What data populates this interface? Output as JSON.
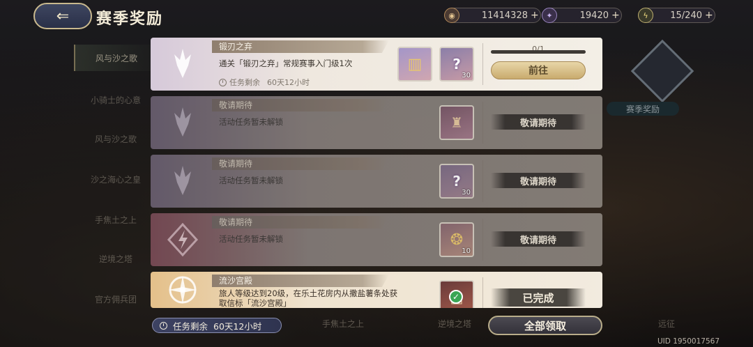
{
  "header": {
    "title": "赛季奖励",
    "back_icon": "back-arrow-icon"
  },
  "currencies": [
    {
      "icon": "coin-icon",
      "value": "11414328"
    },
    {
      "icon": "star-gem-icon",
      "value": "19420"
    },
    {
      "icon": "lightning-icon",
      "value": "15/240"
    }
  ],
  "sidebar": {
    "items": [
      {
        "label": "风与沙之歌",
        "active": true
      },
      {
        "label": "小骑士的心意"
      },
      {
        "label": "风与沙之歌"
      },
      {
        "label": "沙之海心之皇"
      },
      {
        "label": "手焦土之上"
      },
      {
        "label": "逆境之塔"
      },
      {
        "label": "官方佣兵团"
      }
    ]
  },
  "right_panel": {
    "season_label": "赛季奖励"
  },
  "tasks": [
    {
      "state": "active",
      "title": "锻刃之弃",
      "desc": "通关「锻刃之弃」常规赛事入门级1次",
      "time_label": "任务剩余",
      "time_value": "60天12小时",
      "rewards": [
        {
          "qty": ""
        },
        {
          "qty": "30",
          "mystery": "?"
        }
      ],
      "progress": "0/1",
      "button": "前往"
    },
    {
      "state": "locked",
      "title": "敬请期待",
      "desc": "活动任务暂未解锁",
      "rewards": [
        {
          "qty": ""
        }
      ],
      "button": "敬请期待"
    },
    {
      "state": "locked",
      "title": "敬请期待",
      "desc": "活动任务暂未解锁",
      "rewards": [
        {
          "qty": "30",
          "mystery": "?"
        }
      ],
      "button": "敬请期待"
    },
    {
      "state": "locked",
      "title": "敬请期待",
      "desc": "活动任务暂未解锁",
      "rewards": [
        {
          "qty": "10"
        }
      ],
      "button": "敬请期待"
    },
    {
      "state": "done",
      "title": "流沙宫殿",
      "desc": "旅人等级达到20级，在乐土花房内从撒盐薯条处获取信标「流沙宫殿」",
      "rewards": [
        {
          "qty": ""
        }
      ],
      "button": "已完成"
    }
  ],
  "bottom": {
    "timer_label": "任务剩余",
    "timer_value": "60天12小时",
    "claim_all": "全部领取",
    "uid": "UID 1950017567",
    "tabs": [
      "手焦土之上",
      "逆境之塔",
      "远征"
    ]
  }
}
